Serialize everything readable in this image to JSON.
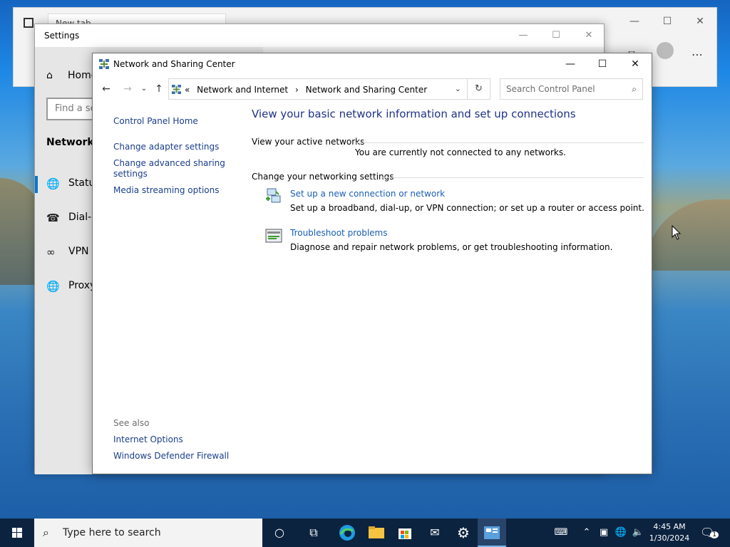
{
  "browser": {
    "tab_title": "New tab",
    "minimize": "—",
    "maximize": "☐",
    "close": "✕",
    "menu": "⋯"
  },
  "settings": {
    "title": "Settings",
    "home": "Home",
    "find_placeholder": "Find a se",
    "section": "Network &",
    "nav": [
      {
        "label": "Status",
        "icon": "globe-icon"
      },
      {
        "label": "Dial-u",
        "icon": "dialup-icon"
      },
      {
        "label": "VPN",
        "icon": "vpn-icon"
      },
      {
        "label": "Proxy",
        "icon": "globe-icon"
      }
    ]
  },
  "nsc": {
    "title": "Network and Sharing Center",
    "breadcrumbs": [
      "«",
      "Network and Internet",
      "›",
      "Network and Sharing Center"
    ],
    "search_placeholder": "Search Control Panel",
    "left_links": {
      "home": "Control Panel Home",
      "adapter": "Change adapter settings",
      "advanced_1": "Change advanced sharing",
      "advanced_2": "settings",
      "media": "Media streaming options",
      "see_also": "See also",
      "internet_options": "Internet Options",
      "firewall": "Windows Defender Firewall"
    },
    "heading": "View your basic network information and set up connections",
    "active_networks_label": "View your active networks",
    "not_connected": "You are currently not connected to any networks.",
    "change_settings_label": "Change your networking settings",
    "setup_link": "Set up a new connection or network",
    "setup_desc": "Set up a broadband, dial-up, or VPN connection; or set up a router or access point.",
    "troubleshoot_link": "Troubleshoot problems",
    "troubleshoot_desc": "Diagnose and repair network problems, or get troubleshooting information."
  },
  "taskbar": {
    "search_placeholder": "Type here to search",
    "time": "4:45 AM",
    "date": "1/30/2024",
    "notification_count": "1"
  },
  "colors": {
    "accent": "#0078d7",
    "link": "#1a5fb4",
    "heading": "#1e3287",
    "taskbar": "#0c2340"
  }
}
